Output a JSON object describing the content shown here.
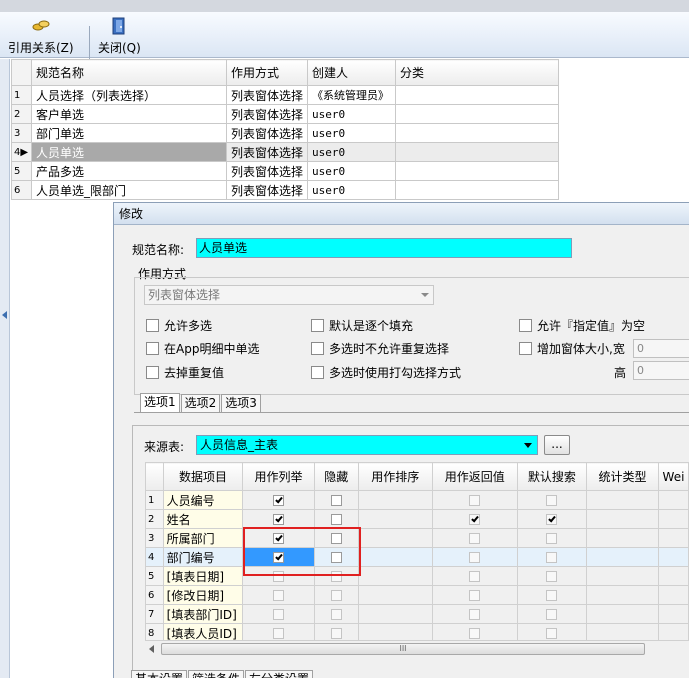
{
  "toolbar": {
    "ref_label": "引用关系(Z)",
    "close_label": "关闭(Q)"
  },
  "main_table": {
    "headers": [
      "规范名称",
      "作用方式",
      "创建人",
      "分类"
    ],
    "rows": [
      {
        "num": "1",
        "name": "人员选择（列表选择）",
        "mode": "列表窗体选择",
        "creator": "《系统管理员》",
        "category": ""
      },
      {
        "num": "2",
        "name": "客户单选",
        "mode": "列表窗体选择",
        "creator": "user0",
        "category": ""
      },
      {
        "num": "3",
        "name": "部门单选",
        "mode": "列表窗体选择",
        "creator": "user0",
        "category": ""
      },
      {
        "num": "4▶",
        "name": "人员单选",
        "mode": "列表窗体选择",
        "creator": "user0",
        "category": ""
      },
      {
        "num": "5",
        "name": "产品多选",
        "mode": "列表窗体选择",
        "creator": "user0",
        "category": ""
      },
      {
        "num": "6",
        "name": "人员单选_限部门",
        "mode": "列表窗体选择",
        "creator": "user0",
        "category": ""
      }
    ]
  },
  "dialog": {
    "title": "修改",
    "name_label": "规范名称:",
    "name_value": "人员单选",
    "mode_group": "作用方式",
    "mode_value": "列表窗体选择",
    "checkboxes": {
      "allow_multi": "允许多选",
      "single_in_detail": "在App明细中单选",
      "dedupe": "去掉重复值",
      "default_fill": "默认是逐个填充",
      "no_dup_multi": "多选时不允许重复选择",
      "tick_mode": "多选时使用打勾选择方式",
      "allow_empty": "允许『指定值』为空",
      "enlarge": "增加窗体大小,宽"
    },
    "width_value": "0",
    "height_label": "高",
    "height_value": "0",
    "tabs": [
      "选项1",
      "选项2",
      "选项3"
    ],
    "source_label": "来源表:",
    "source_value": "人员信息_主表",
    "dots_label": "...",
    "grid_headers": [
      "数据项目",
      "用作列举",
      "隐藏",
      "用作排序",
      "用作返回值",
      "默认搜索",
      "统计类型",
      "Wei"
    ],
    "grid_rows": [
      {
        "num": "1",
        "item": "人员编号",
        "list": true,
        "hide": false,
        "sort": false,
        "ret": false,
        "search": false
      },
      {
        "num": "2",
        "item": "姓名",
        "list": true,
        "hide": false,
        "sort": false,
        "ret": true,
        "search": true
      },
      {
        "num": "3",
        "item": "所属部门",
        "list": true,
        "hide": false,
        "sort": false,
        "ret": false,
        "search": false
      },
      {
        "num": "4",
        "item": "部门编号",
        "list": true,
        "hide": false,
        "sort": false,
        "ret": false,
        "search": false
      },
      {
        "num": "5",
        "item": "[填表日期]",
        "list": false,
        "hide": false,
        "sort": false,
        "ret": false,
        "search": false
      },
      {
        "num": "6",
        "item": "[修改日期]",
        "list": false,
        "hide": false,
        "sort": false,
        "ret": false,
        "search": false
      },
      {
        "num": "7",
        "item": "[填表部门ID]",
        "list": false,
        "hide": false,
        "sort": false,
        "ret": false,
        "search": false
      },
      {
        "num": "8",
        "item": "[填表人员ID]",
        "list": false,
        "hide": false,
        "sort": false,
        "ret": false,
        "search": false
      }
    ],
    "scroll_grip": "III",
    "bottom_tabs": [
      "基本设置",
      "筛选条件",
      "左分类设置"
    ]
  },
  "colors": {
    "highlight": "#00ffff",
    "annotation": "#e02020",
    "selection": "#3399ff"
  }
}
